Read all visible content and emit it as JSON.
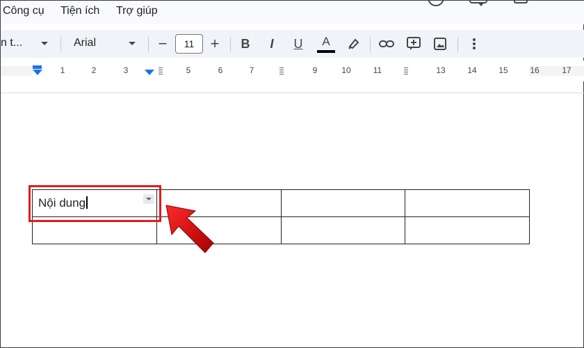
{
  "menu": {
    "items": [
      "Công cụ",
      "Tiện ích",
      "Trợ giúp"
    ]
  },
  "toolbar": {
    "style_label": "n t...",
    "font_label": "Arial",
    "font_size": "11",
    "minus": "−",
    "plus": "+",
    "bold": "B",
    "italic": "I",
    "underline": "U",
    "text_color": "A"
  },
  "ruler": {
    "numbers": [
      "1",
      "2",
      "3",
      "5",
      "6",
      "7",
      "9",
      "10",
      "11",
      "13",
      "14",
      "15",
      "16",
      "17"
    ],
    "accent": "#1a73e8"
  },
  "table": {
    "rows": [
      [
        "Nội dung",
        "",
        "",
        ""
      ],
      [
        "",
        "",
        "",
        ""
      ]
    ]
  },
  "colors": {
    "highlight": "#e51a1a",
    "toolbar_bg": "#f0f4f9"
  }
}
